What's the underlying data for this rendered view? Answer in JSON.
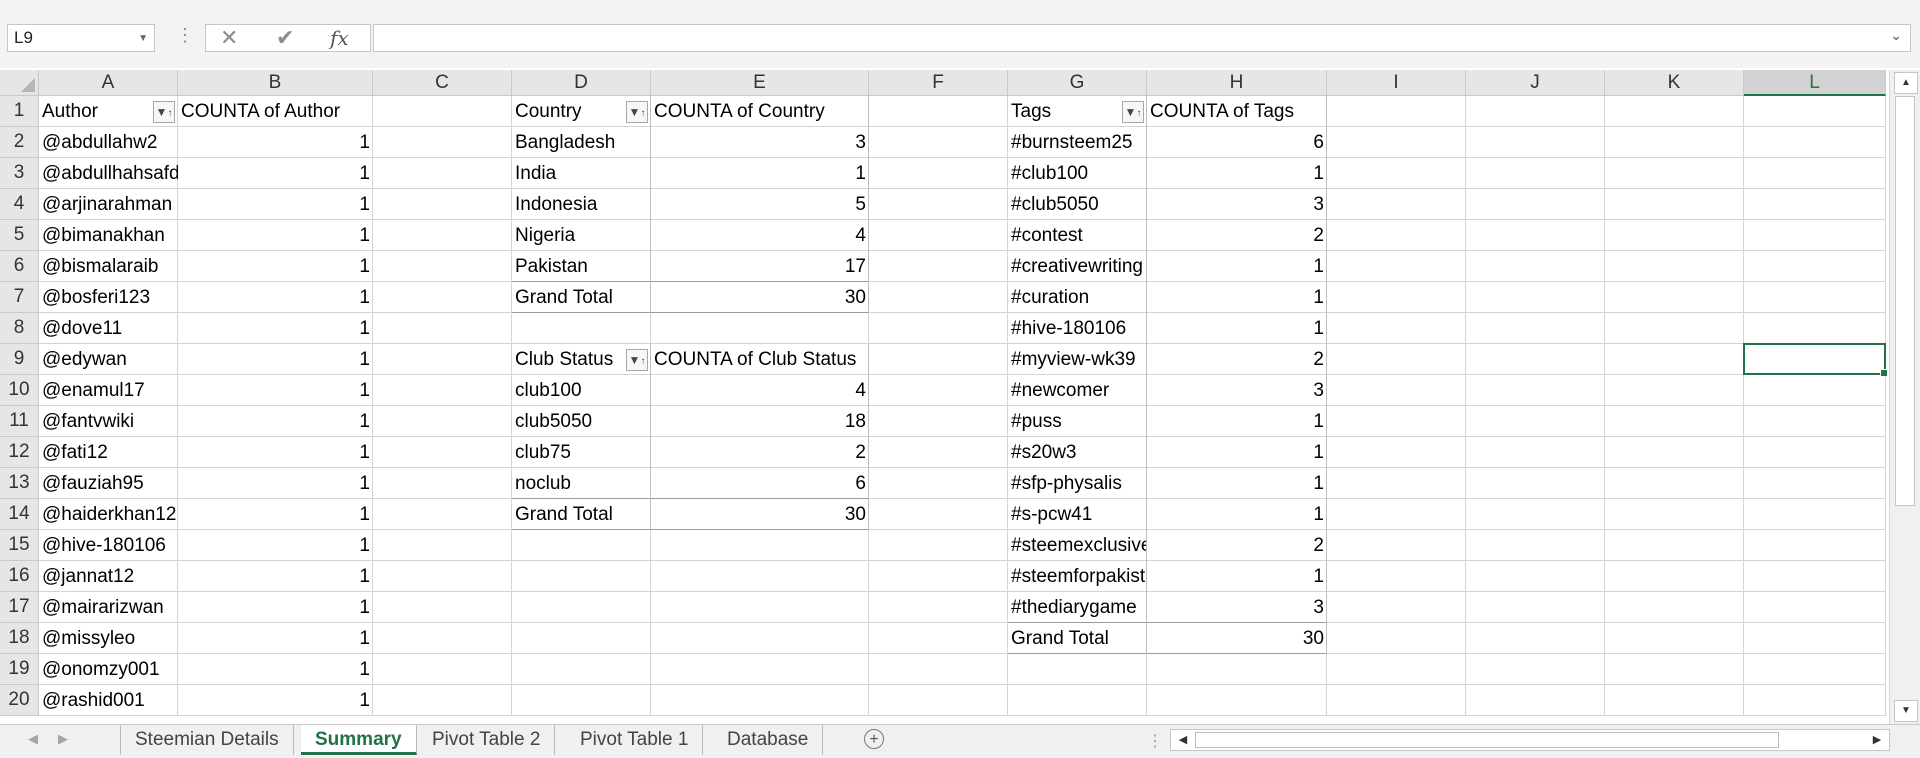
{
  "formula_bar": {
    "name_box": "L9",
    "cancel_icon": "close-icon",
    "enter_icon": "check-icon",
    "fx_label": "fx",
    "formula_value": ""
  },
  "columns": [
    "A",
    "B",
    "C",
    "D",
    "E",
    "F",
    "G",
    "H",
    "I",
    "J",
    "K",
    "L"
  ],
  "selected_column": "L",
  "selected_cell": "L9",
  "rows": [
    "1",
    "2",
    "3",
    "4",
    "5",
    "6",
    "7",
    "8",
    "9",
    "10",
    "11",
    "12",
    "13",
    "14",
    "15",
    "16",
    "17",
    "18",
    "19",
    "20"
  ],
  "author_table": {
    "header_label": "Author",
    "header_count": "COUNTA of Author",
    "rows": [
      {
        "label": "@abdullahw2",
        "count": "1"
      },
      {
        "label": "@abdullhahsafdar",
        "count": "1"
      },
      {
        "label": "@arjinarahman",
        "count": "1"
      },
      {
        "label": "@bimanakhan",
        "count": "1"
      },
      {
        "label": "@bismalaraib",
        "count": "1"
      },
      {
        "label": "@bosferi123",
        "count": "1"
      },
      {
        "label": "@dove11",
        "count": "1"
      },
      {
        "label": "@edywan",
        "count": "1"
      },
      {
        "label": "@enamul17",
        "count": "1"
      },
      {
        "label": "@fantvwiki",
        "count": "1"
      },
      {
        "label": "@fati12",
        "count": "1"
      },
      {
        "label": "@fauziah95",
        "count": "1"
      },
      {
        "label": "@haiderkhan12",
        "count": "1"
      },
      {
        "label": "@hive-180106",
        "count": "1"
      },
      {
        "label": "@jannat12",
        "count": "1"
      },
      {
        "label": "@mairarizwan",
        "count": "1"
      },
      {
        "label": "@missyleo",
        "count": "1"
      },
      {
        "label": "@onomzy001",
        "count": "1"
      },
      {
        "label": "@rashid001",
        "count": "1"
      }
    ]
  },
  "country_table": {
    "header_label": "Country",
    "header_count": "COUNTA of Country",
    "rows": [
      {
        "label": "Bangladesh",
        "count": "3"
      },
      {
        "label": "India",
        "count": "1"
      },
      {
        "label": "Indonesia",
        "count": "5"
      },
      {
        "label": "Nigeria",
        "count": "4"
      },
      {
        "label": "Pakistan",
        "count": "17"
      }
    ],
    "total_label": "Grand Total",
    "total_count": "30"
  },
  "club_table": {
    "header_label": "Club Status",
    "header_count": "COUNTA of Club Status",
    "rows": [
      {
        "label": "club100",
        "count": "4"
      },
      {
        "label": "club5050",
        "count": "18"
      },
      {
        "label": "club75",
        "count": "2"
      },
      {
        "label": "noclub",
        "count": "6"
      }
    ],
    "total_label": "Grand Total",
    "total_count": "30"
  },
  "tags_table": {
    "header_label": "Tags",
    "header_count": "COUNTA of Tags",
    "rows": [
      {
        "label": "#burnsteem25",
        "count": "6"
      },
      {
        "label": "#club100",
        "count": "1"
      },
      {
        "label": "#club5050",
        "count": "3"
      },
      {
        "label": "#contest",
        "count": "2"
      },
      {
        "label": "#creativewriting",
        "count": "1"
      },
      {
        "label": "#curation",
        "count": "1"
      },
      {
        "label": "#hive-180106",
        "count": "1"
      },
      {
        "label": "#myview-wk39",
        "count": "2"
      },
      {
        "label": "#newcomer",
        "count": "3"
      },
      {
        "label": "#puss",
        "count": "1"
      },
      {
        "label": "#s20w3",
        "count": "1"
      },
      {
        "label": "#sfp-physalis",
        "count": "1"
      },
      {
        "label": "#s-pcw41",
        "count": "1"
      },
      {
        "label": "#steemexclusive",
        "count": "2"
      },
      {
        "label": "#steemforpakistan",
        "count": "1"
      },
      {
        "label": "#thediarygame",
        "count": "3"
      }
    ],
    "total_label": "Grand Total",
    "total_count": "30"
  },
  "sheet_tabs": [
    {
      "label": "Steemian Details",
      "active": false
    },
    {
      "label": "Summary",
      "active": true
    },
    {
      "label": "Pivot Table 2",
      "active": false
    },
    {
      "label": "Pivot Table 1",
      "active": false
    },
    {
      "label": "Database",
      "active": false
    }
  ],
  "colors": {
    "accent": "#217346",
    "header_bg": "#e6e6e6",
    "gridline": "#d4d4d4"
  }
}
